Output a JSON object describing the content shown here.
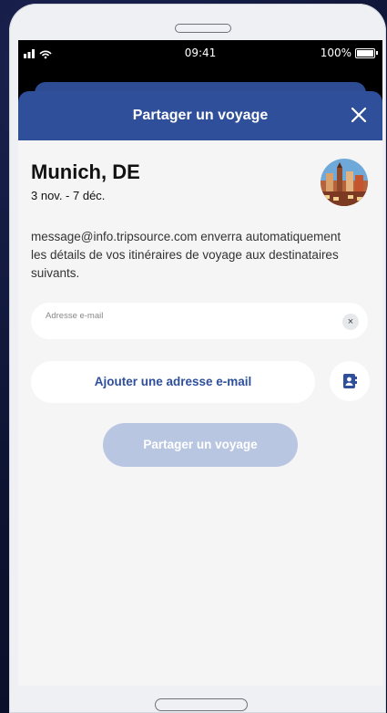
{
  "status_bar": {
    "time": "09:41",
    "battery": "100%"
  },
  "modal": {
    "title": "Partager un voyage",
    "close_icon": "close-icon"
  },
  "trip": {
    "destination": "Munich, DE",
    "dates": "3 nov. - 7 déc.",
    "image_icon": "munich-photo"
  },
  "description": "message@info.tripsource.com enverra automatiquement les détails de vos itinéraires de voyage aux destinataires suivants.",
  "email_field": {
    "placeholder": "Adresse e-mail",
    "value": "",
    "clear_label": "×"
  },
  "add_email_button": {
    "label": "Ajouter une adresse e-mail"
  },
  "contacts_icon": "contacts-book-icon",
  "share_button": {
    "label": "Partager un voyage",
    "enabled": false
  },
  "colors": {
    "header": "#2f4f9b",
    "accent": "#2f4f9b",
    "disabled_button": "#b9c6e2",
    "background": "#f5f5f6"
  }
}
